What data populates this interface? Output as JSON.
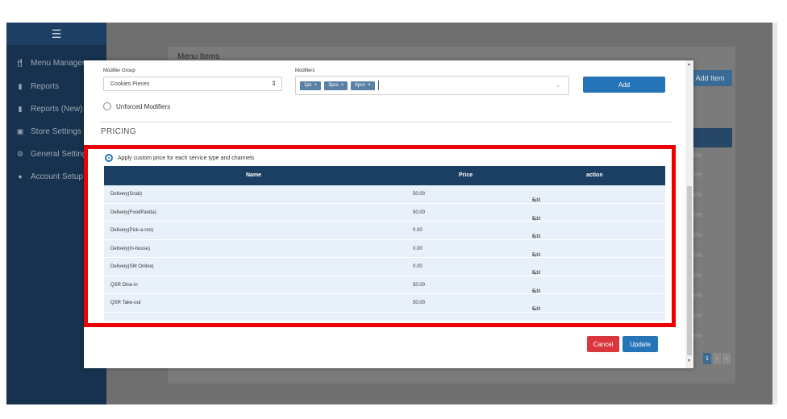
{
  "sidebar": {
    "items": [
      {
        "label": "Menu Managem",
        "icon": "fork-knife-icon"
      },
      {
        "label": "Reports",
        "icon": "file-icon"
      },
      {
        "label": "Reports (New)",
        "icon": "file-icon"
      },
      {
        "label": "Store Settings",
        "icon": "store-icon"
      },
      {
        "label": "General Settings",
        "icon": "gear-icon"
      },
      {
        "label": "Account Setup",
        "icon": "user-icon"
      }
    ]
  },
  "background": {
    "title": "Menu Items",
    "add_item_label": "Add Item",
    "delete_label": "lete",
    "page_number": "1"
  },
  "modal": {
    "modifier_group_label": "Modifier Group",
    "modifier_group_value": "Cookies Pieces",
    "modifiers_label": "Modifiers",
    "modifier_tags": [
      "1pc",
      "3pcs",
      "6pcs"
    ],
    "add_label": "Add",
    "unforced_label": "Unforced Modifiers",
    "pricing_label": "PRICING",
    "custom_price_label": "Apply custom price for each service type and channels",
    "table": {
      "headers": {
        "name": "Name",
        "price": "Price",
        "action": "action"
      },
      "rows": [
        {
          "name": "Delivery(Grab)",
          "price": "50.00",
          "action": "Edit"
        },
        {
          "name": "Delivery(FoodPanda)",
          "price": "50.00",
          "action": "Edit"
        },
        {
          "name": "Delivery(Pick-a-roo)",
          "price": "0.00",
          "action": "Edit"
        },
        {
          "name": "Delivery(In-house)",
          "price": "0.00",
          "action": "Edit"
        },
        {
          "name": "Delivery(SM Online)",
          "price": "0.00",
          "action": "Edit"
        },
        {
          "name": "QSR Dine-in",
          "price": "50.00",
          "action": "Edit"
        },
        {
          "name": "QSR Take-out",
          "price": "50.00",
          "action": "Edit"
        }
      ]
    },
    "cancel_label": "Cancel",
    "update_label": "Update"
  },
  "colors": {
    "sidebar": "#17324f",
    "table_header": "#1b3e63",
    "primary": "#2574b8",
    "danger": "#d9363e",
    "highlight": "#ee0000"
  }
}
